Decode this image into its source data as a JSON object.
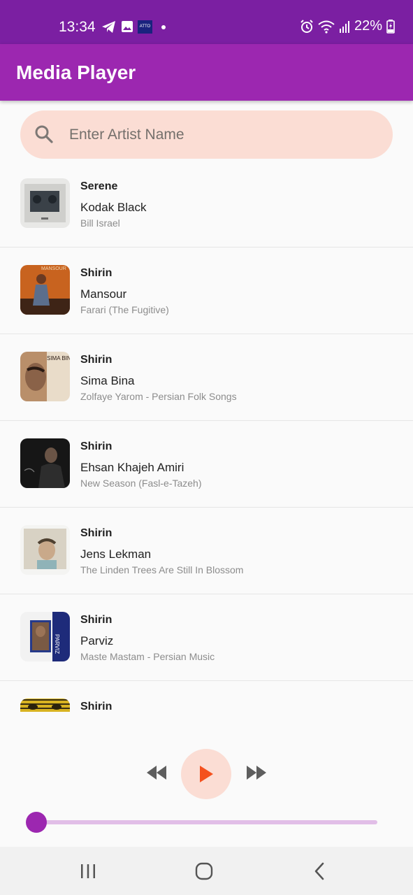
{
  "status_bar": {
    "time": "13:34",
    "notification_icons": [
      "telegram-icon",
      "gallery-icon",
      "atto-icon",
      "dot-icon"
    ],
    "atto_label": "ATTO",
    "system_icons": [
      "alarm-icon",
      "wifi-icon",
      "signal-icon",
      "battery-charging-icon"
    ],
    "battery": "22%"
  },
  "app_bar": {
    "title": "Media Player"
  },
  "search": {
    "placeholder": "Enter Artist Name",
    "value": ""
  },
  "tracks": [
    {
      "title": "Serene",
      "artist": "Kodak Black",
      "album": "Bill Israel"
    },
    {
      "title": "Shirin",
      "artist": "Mansour",
      "album": "Farari (The Fugitive)",
      "cover_text": "MANSOUR"
    },
    {
      "title": "Shirin",
      "artist": "Sima Bina",
      "album": "Zolfaye Yarom - Persian Folk Songs",
      "cover_text": "SIMA BINA"
    },
    {
      "title": "Shirin",
      "artist": "Ehsan Khajeh Amiri",
      "album": "New Season (Fasl-e-Tazeh)"
    },
    {
      "title": "Shirin",
      "artist": "Jens Lekman",
      "album": "The Linden Trees Are Still In Blossom"
    },
    {
      "title": "Shirin",
      "artist": "Parviz",
      "album": "Maste Mastam - Persian Music",
      "cover_text": "PARVIZ"
    },
    {
      "title": "Shirin",
      "artist": "",
      "album": ""
    }
  ],
  "player": {
    "controls": [
      "rewind-icon",
      "play-icon",
      "fast-forward-icon"
    ],
    "progress": 0.0
  },
  "nav_bar": {
    "buttons": [
      "recents-icon",
      "home-icon",
      "back-icon"
    ]
  },
  "colors": {
    "status_bar": "#7b1fa2",
    "app_bar": "#9c27b0",
    "search_background": "#fbddd4",
    "play_accent": "#f4511e",
    "slider_track": "#e1bee7",
    "slider_thumb": "#9c27b0"
  }
}
